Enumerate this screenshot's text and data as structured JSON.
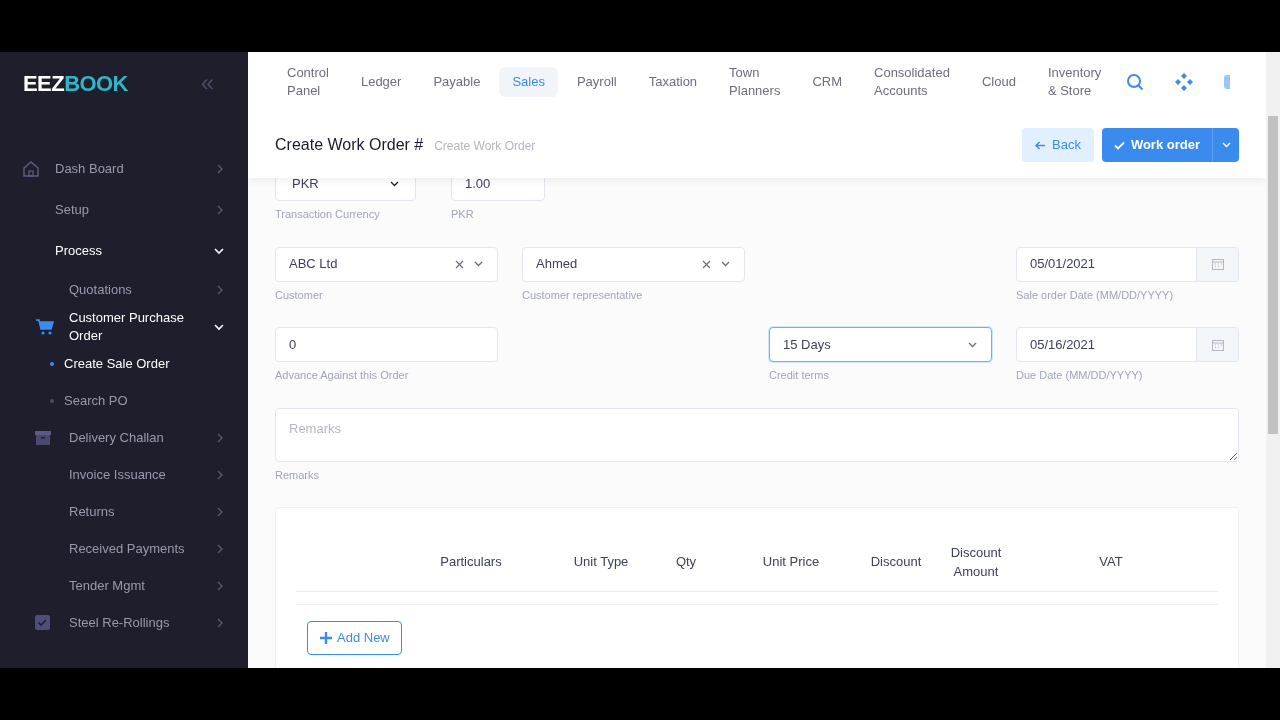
{
  "sidebar": {
    "logo_first": "EEZ",
    "logo_second": "BOOK",
    "collapse_label": "«",
    "items": [
      {
        "label": "Dash Board",
        "expanded": false
      },
      {
        "label": "Setup",
        "expanded": false
      },
      {
        "label": "Process",
        "expanded": true,
        "children": [
          {
            "label": "Quotations",
            "expanded": false
          },
          {
            "label": "Customer Purchase Order",
            "expanded": true,
            "children": [
              {
                "label": "Create Sale Order",
                "selected": true
              },
              {
                "label": "Search PO",
                "selected": false
              }
            ]
          },
          {
            "label": "Delivery Challan",
            "expanded": false
          },
          {
            "label": "Invoice Issuance",
            "expanded": false
          },
          {
            "label": "Returns",
            "expanded": false
          },
          {
            "label": "Received Payments",
            "expanded": false
          },
          {
            "label": "Tender Mgmt",
            "expanded": false
          },
          {
            "label": "Steel Re-Rollings",
            "expanded": false
          }
        ]
      }
    ]
  },
  "nav_tabs": [
    {
      "label": "Control\nPanel",
      "selected": false
    },
    {
      "label": "Ledger",
      "selected": false
    },
    {
      "label": "Payable",
      "selected": false
    },
    {
      "label": "Sales",
      "selected": true
    },
    {
      "label": "Payroll",
      "selected": false
    },
    {
      "label": "Taxation",
      "selected": false
    },
    {
      "label": "Town\nPlanners",
      "selected": false
    },
    {
      "label": "CRM",
      "selected": false
    },
    {
      "label": "Consolidated\nAccounts",
      "selected": false
    },
    {
      "label": "Cloud",
      "selected": false
    },
    {
      "label": "Inventory\n& Store",
      "selected": false
    }
  ],
  "header": {
    "title": "Create Work Order #",
    "breadcrumb": "Create Work Order",
    "back_button": "Back",
    "primary_button": "Work order"
  },
  "form": {
    "currency": {
      "value": "PKR",
      "label": "Transaction Currency"
    },
    "rate": {
      "value": "1.00",
      "label": "PKR"
    },
    "customer": {
      "value": "ABC Ltd",
      "label": "Customer"
    },
    "representative": {
      "value": "Ahmed",
      "label": "Customer representative"
    },
    "sale_order_date": {
      "value": "05/01/2021",
      "label": "Sale order Date (MM/DD/YYYY)"
    },
    "advance": {
      "value": "0",
      "label": "Advance Against this Order"
    },
    "credit_terms": {
      "value": "15 Days",
      "label": "Credit terms",
      "focused": true
    },
    "due_date": {
      "value": "05/16/2021",
      "label": "Due Date (MM/DD/YYYY)"
    },
    "remarks": {
      "placeholder": "Remarks",
      "label": "Remarks"
    }
  },
  "table": {
    "columns": [
      "Particulars",
      "Unit Type",
      "Qty",
      "Unit Price",
      "Discount",
      "Discount\nAmount",
      "VAT"
    ],
    "add_button": "Add New"
  }
}
